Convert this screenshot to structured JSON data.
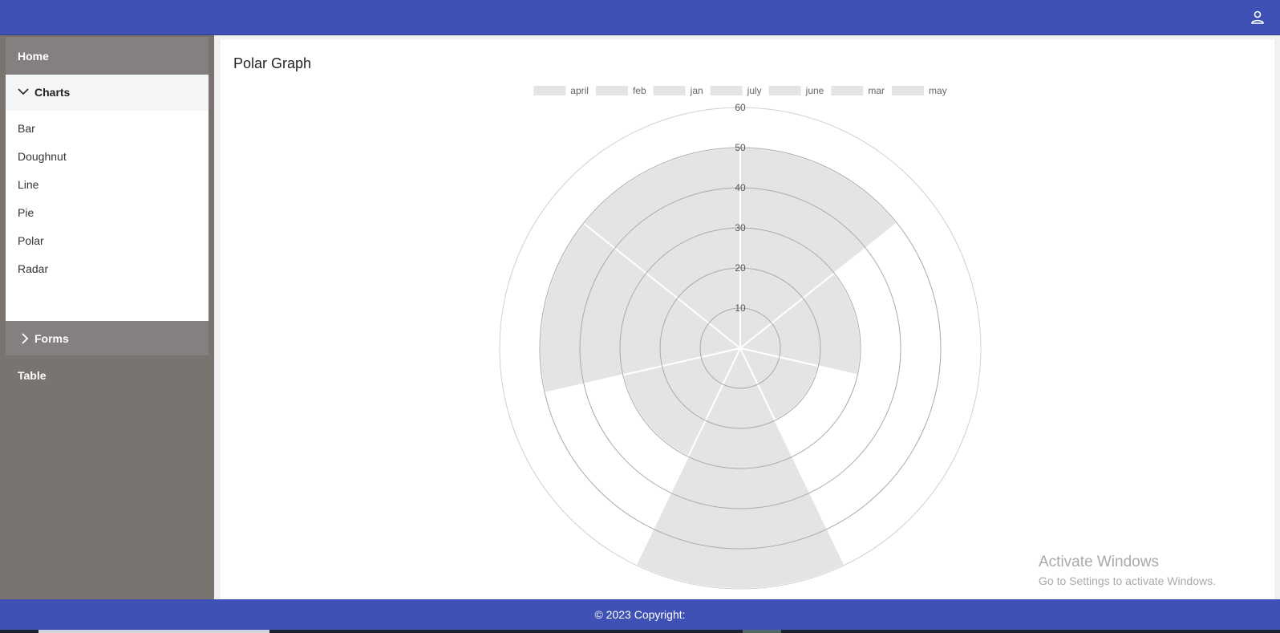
{
  "header": {
    "user_icon": "user-icon",
    "color": "#3f51b5"
  },
  "sidebar": {
    "home": "Home",
    "charts": {
      "label": "Charts",
      "expanded": true,
      "items": [
        "Bar",
        "Doughnut",
        "Line",
        "Pie",
        "Polar",
        "Radar"
      ]
    },
    "forms": {
      "label": "Forms",
      "expanded": false
    },
    "table": "Table"
  },
  "page": {
    "title": "Polar Graph"
  },
  "chart_data": {
    "type": "polarArea",
    "categories": [
      "april",
      "feb",
      "jan",
      "july",
      "june",
      "mar",
      "may"
    ],
    "values": [
      50,
      30,
      20,
      60,
      30,
      50,
      50
    ],
    "rlim": [
      0,
      60
    ],
    "r_ticks": [
      10,
      20,
      30,
      40,
      50,
      60
    ],
    "fill_color": "#e4e4e4",
    "legend_position": "top"
  },
  "watermark": {
    "line1": "Activate Windows",
    "line2": "Go to Settings to activate Windows."
  },
  "footer": {
    "text": "© 2023 Copyright:"
  }
}
